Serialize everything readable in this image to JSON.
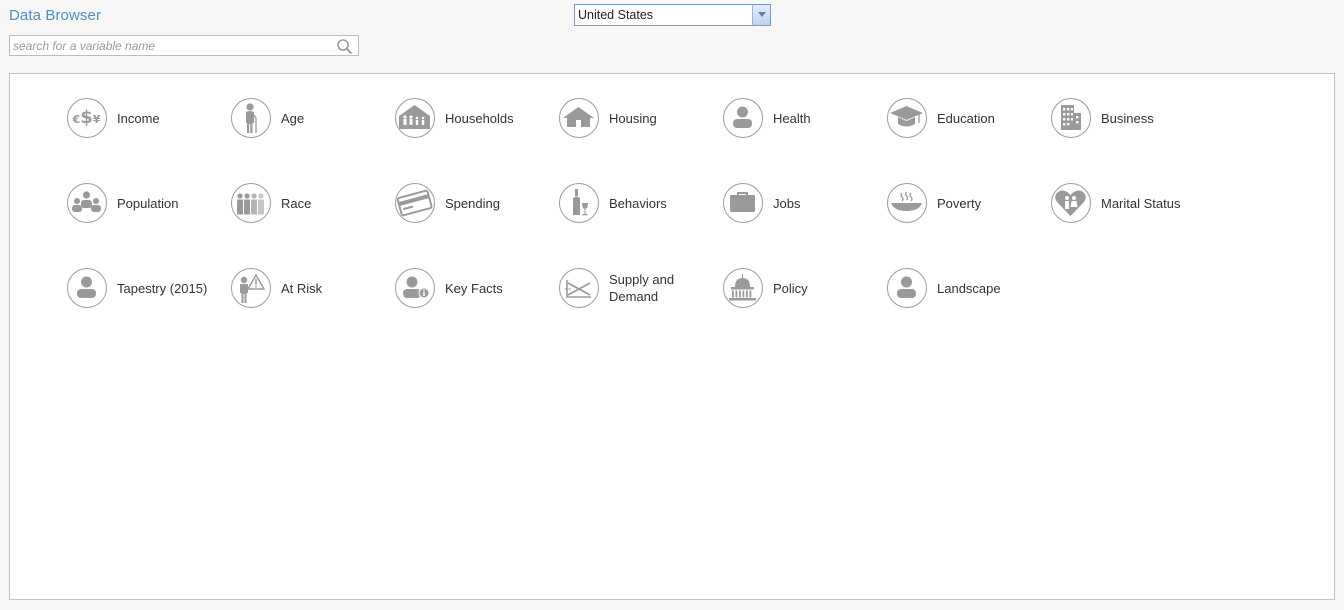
{
  "app": {
    "title": "Data Browser"
  },
  "search": {
    "placeholder": "search for a variable name",
    "value": ""
  },
  "country": {
    "selected": "United States"
  },
  "categories": [
    {
      "label": "Income",
      "icon": "currency-icon"
    },
    {
      "label": "Age",
      "icon": "elderly-person-icon"
    },
    {
      "label": "Households",
      "icon": "household-icon"
    },
    {
      "label": "Housing",
      "icon": "house-icon"
    },
    {
      "label": "Health",
      "icon": "person-icon"
    },
    {
      "label": "Education",
      "icon": "graduation-cap-icon"
    },
    {
      "label": "Business",
      "icon": "building-icon"
    },
    {
      "label": "Population",
      "icon": "group-icon"
    },
    {
      "label": "Race",
      "icon": "people-icon"
    },
    {
      "label": "Spending",
      "icon": "credit-card-icon"
    },
    {
      "label": "Behaviors",
      "icon": "wine-icon"
    },
    {
      "label": "Jobs",
      "icon": "briefcase-icon"
    },
    {
      "label": "Poverty",
      "icon": "food-bowl-icon"
    },
    {
      "label": "Marital Status",
      "icon": "heart-couple-icon"
    },
    {
      "label": "Tapestry (2015)",
      "icon": "person-icon"
    },
    {
      "label": "At Risk",
      "icon": "warning-person-icon"
    },
    {
      "label": "Key Facts",
      "icon": "person-info-icon"
    },
    {
      "label": "Supply and Demand",
      "icon": "supply-demand-icon"
    },
    {
      "label": "Policy",
      "icon": "capitol-icon"
    },
    {
      "label": "Landscape",
      "icon": "person-icon"
    }
  ]
}
